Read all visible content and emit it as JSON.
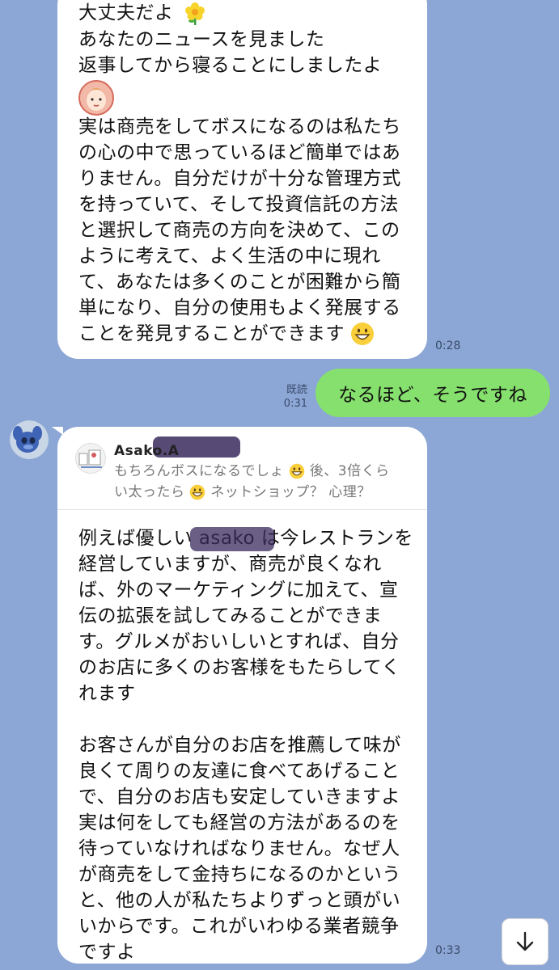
{
  "messages": {
    "received_1": {
      "lines": [
        "大丈夫だよ",
        "あなたのニュースを見ました",
        "返事してから寝ることにしましたよ",
        "",
        "実は商売をしてボスになるのは私たち",
        "の心の中で思っているほど簡単ではあ",
        "りません。自分だけが十分な管理方式",
        "を持っていて、そして投資信託の方法",
        "と選択して商売の方向を決めて、この",
        "ように考えて、よく生活の中に現れ",
        "て、あなたは多くのことが困難から簡",
        "単になり、自分の使用もよく発展する",
        "ことを発見することができます"
      ],
      "time": "0:28"
    },
    "sent_1": {
      "text": "なるほど、そうですね",
      "read_label": "既読",
      "time": "0:31"
    },
    "received_2": {
      "quote": {
        "name": "Asako.A",
        "line1": "もちろんボスになるでしょ",
        "line1_tail": " 後、3倍くら",
        "line2": "い太ったら",
        "line2_tail": " ネットショップ？ 心理？"
      },
      "paragraph1": [
        "例えば優しい asako は今レストランを",
        "経営していますが、商売が良くなれ",
        "ば、外のマーケティングに加えて、宣",
        "伝の拡張を試してみることができま",
        "す。グルメがおいしいとすれば、自分",
        "のお店に多くのお客様をもたらしてく",
        "れます"
      ],
      "paragraph2": [
        "お客さんが自分のお店を推薦して味が",
        "良くて周りの友達に食べてあげること",
        "で、自分のお店も安定していきますよ",
        "実は何をしても経営の方法があるのを",
        "待っていなければなりません。なぜ人",
        "が商売をして金持ちになるのかという",
        "と、他の人が私たちよりずっと頭がい",
        "いからです。これがいわゆる業者競争",
        "ですよ"
      ],
      "time": "0:33"
    }
  },
  "icons": {
    "flower": "flower-emoji",
    "girl_sticker": "girl-face-emoji",
    "grin": "grinning-face-emoji",
    "scroll_down": "arrow-down-icon"
  },
  "colors": {
    "background": "#8ca7d5",
    "sent_bubble": "#86e06d",
    "received_bubble": "#ffffff"
  }
}
